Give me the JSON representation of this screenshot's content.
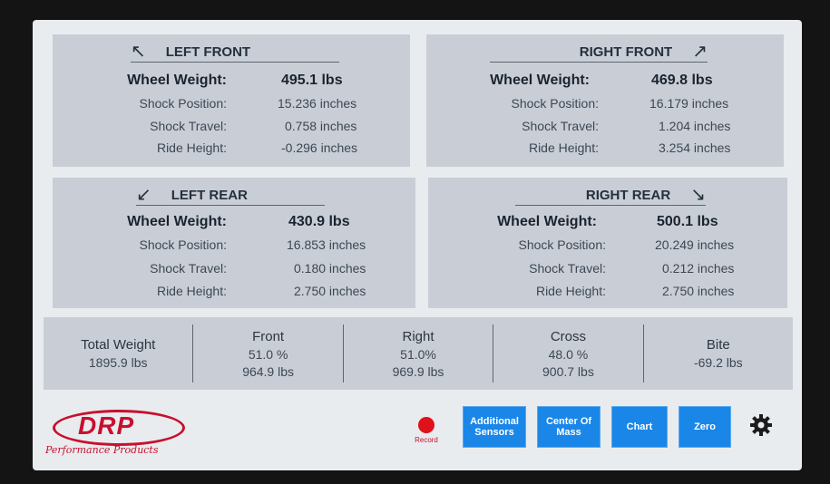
{
  "panels": {
    "left_front": {
      "title": "LEFT FRONT",
      "arrow": "↖",
      "wheel_weight_label": "Wheel Weight:",
      "wheel_weight": "495.1 lbs",
      "shock_position_label": "Shock Position:",
      "shock_position": "15.236 inches",
      "shock_travel_label": "Shock Travel:",
      "shock_travel": "0.758 inches",
      "ride_height_label": "Ride Height:",
      "ride_height": "-0.296 inches"
    },
    "right_front": {
      "title": "RIGHT FRONT",
      "arrow": "↗",
      "wheel_weight_label": "Wheel Weight:",
      "wheel_weight": "469.8 lbs",
      "shock_position_label": "Shock Position:",
      "shock_position": "16.179 inches",
      "shock_travel_label": "Shock Travel:",
      "shock_travel": "1.204 inches",
      "ride_height_label": "Ride Height:",
      "ride_height": "3.254 inches"
    },
    "left_rear": {
      "title": "LEFT REAR",
      "arrow": "↙",
      "wheel_weight_label": "Wheel Weight:",
      "wheel_weight": "430.9 lbs",
      "shock_position_label": "Shock Position:",
      "shock_position": "16.853 inches",
      "shock_travel_label": "Shock Travel:",
      "shock_travel": "0.180 inches",
      "ride_height_label": "Ride Height:",
      "ride_height": "2.750 inches"
    },
    "right_rear": {
      "title": "RIGHT REAR",
      "arrow": "↘",
      "wheel_weight_label": "Wheel Weight:",
      "wheel_weight": "500.1 lbs",
      "shock_position_label": "Shock Position:",
      "shock_position": "20.249 inches",
      "shock_travel_label": "Shock Travel:",
      "shock_travel": "0.212 inches",
      "ride_height_label": "Ride Height:",
      "ride_height": "2.750 inches"
    }
  },
  "summary": {
    "total": {
      "title": "Total Weight",
      "value": "1895.9 lbs"
    },
    "front": {
      "title": "Front",
      "percent": "51.0 %",
      "weight": "964.9 lbs"
    },
    "right": {
      "title": "Right",
      "percent": "51.0%",
      "weight": "969.9 lbs"
    },
    "cross": {
      "title": "Cross",
      "percent": "48.0 %",
      "weight": "900.7 lbs"
    },
    "bite": {
      "title": "Bite",
      "value": "-69.2 lbs"
    }
  },
  "footer": {
    "logo_text": "DRP",
    "logo_subtitle": "Performance Products",
    "record_label": "Record",
    "buttons": {
      "additional_sensors": "Additional Sensors",
      "center_of_mass": "Center Of Mass",
      "chart": "Chart",
      "zero": "Zero"
    }
  },
  "colors": {
    "accent": "#1a86e8",
    "panel": "#c9ced6",
    "brand": "#c8102e",
    "record": "#e0111a"
  },
  "icons": {
    "settings": "gear-icon"
  }
}
